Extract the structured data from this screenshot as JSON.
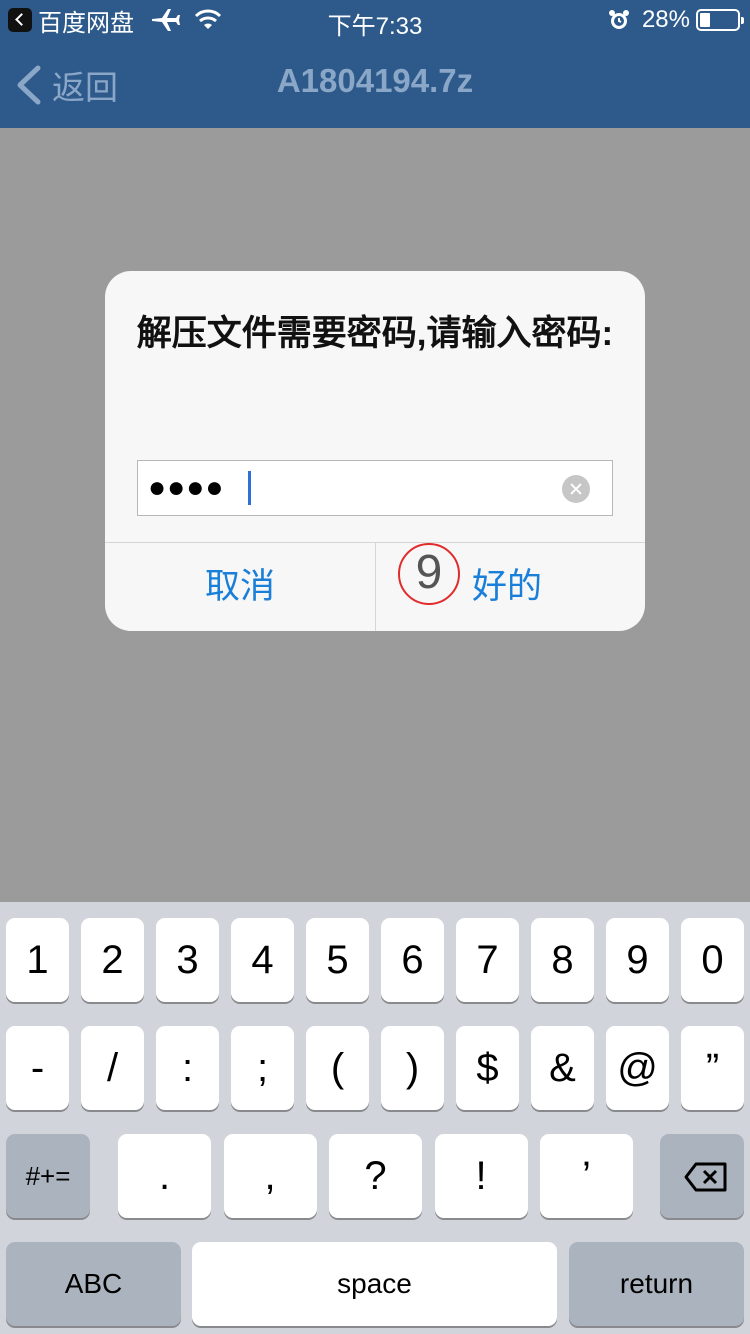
{
  "status_bar": {
    "back_app": "百度网盘",
    "time": "下午7:33",
    "battery_percent": "28%",
    "battery_level": 0.28,
    "icons": [
      "back-app-icon",
      "airplane-icon",
      "wifi-icon",
      "alarm-icon",
      "battery-icon"
    ]
  },
  "nav": {
    "back_label": "返回",
    "title": "A1804194.7z",
    "color": "#2d5a8b"
  },
  "dialog": {
    "message": "解压文件需要密码,请输入密码:",
    "password_masked": "●●●●",
    "cancel_label": "取消",
    "ok_label": "好的",
    "marker": "9",
    "button_color": "#1a7fd9"
  },
  "keyboard": {
    "row1": [
      "1",
      "2",
      "3",
      "4",
      "5",
      "6",
      "7",
      "8",
      "9",
      "0"
    ],
    "row2": [
      "-",
      "/",
      ":",
      ";",
      "(",
      ")",
      "$",
      "&",
      "@",
      "”"
    ],
    "row3_left": "#+=",
    "row3": [
      ".",
      ",",
      "?",
      "!",
      "’"
    ],
    "abc_label": "ABC",
    "space_label": "space",
    "return_label": "return"
  }
}
